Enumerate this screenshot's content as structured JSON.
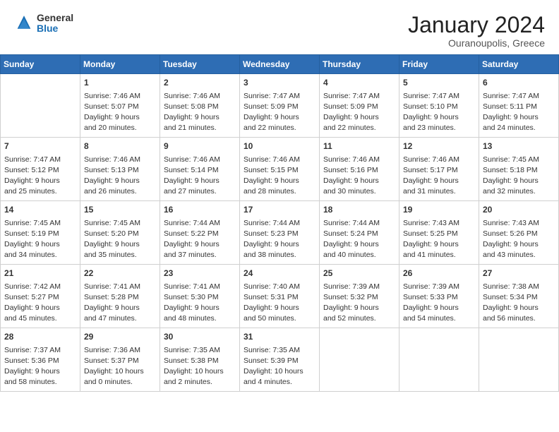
{
  "header": {
    "logo_general": "General",
    "logo_blue": "Blue",
    "month_title": "January 2024",
    "location": "Ouranoupolis, Greece"
  },
  "weekdays": [
    "Sunday",
    "Monday",
    "Tuesday",
    "Wednesday",
    "Thursday",
    "Friday",
    "Saturday"
  ],
  "weeks": [
    [
      {
        "day": "",
        "info": ""
      },
      {
        "day": "1",
        "info": "Sunrise: 7:46 AM\nSunset: 5:07 PM\nDaylight: 9 hours\nand 20 minutes."
      },
      {
        "day": "2",
        "info": "Sunrise: 7:46 AM\nSunset: 5:08 PM\nDaylight: 9 hours\nand 21 minutes."
      },
      {
        "day": "3",
        "info": "Sunrise: 7:47 AM\nSunset: 5:09 PM\nDaylight: 9 hours\nand 22 minutes."
      },
      {
        "day": "4",
        "info": "Sunrise: 7:47 AM\nSunset: 5:09 PM\nDaylight: 9 hours\nand 22 minutes."
      },
      {
        "day": "5",
        "info": "Sunrise: 7:47 AM\nSunset: 5:10 PM\nDaylight: 9 hours\nand 23 minutes."
      },
      {
        "day": "6",
        "info": "Sunrise: 7:47 AM\nSunset: 5:11 PM\nDaylight: 9 hours\nand 24 minutes."
      }
    ],
    [
      {
        "day": "7",
        "info": "Sunrise: 7:47 AM\nSunset: 5:12 PM\nDaylight: 9 hours\nand 25 minutes."
      },
      {
        "day": "8",
        "info": "Sunrise: 7:46 AM\nSunset: 5:13 PM\nDaylight: 9 hours\nand 26 minutes."
      },
      {
        "day": "9",
        "info": "Sunrise: 7:46 AM\nSunset: 5:14 PM\nDaylight: 9 hours\nand 27 minutes."
      },
      {
        "day": "10",
        "info": "Sunrise: 7:46 AM\nSunset: 5:15 PM\nDaylight: 9 hours\nand 28 minutes."
      },
      {
        "day": "11",
        "info": "Sunrise: 7:46 AM\nSunset: 5:16 PM\nDaylight: 9 hours\nand 30 minutes."
      },
      {
        "day": "12",
        "info": "Sunrise: 7:46 AM\nSunset: 5:17 PM\nDaylight: 9 hours\nand 31 minutes."
      },
      {
        "day": "13",
        "info": "Sunrise: 7:45 AM\nSunset: 5:18 PM\nDaylight: 9 hours\nand 32 minutes."
      }
    ],
    [
      {
        "day": "14",
        "info": "Sunrise: 7:45 AM\nSunset: 5:19 PM\nDaylight: 9 hours\nand 34 minutes."
      },
      {
        "day": "15",
        "info": "Sunrise: 7:45 AM\nSunset: 5:20 PM\nDaylight: 9 hours\nand 35 minutes."
      },
      {
        "day": "16",
        "info": "Sunrise: 7:44 AM\nSunset: 5:22 PM\nDaylight: 9 hours\nand 37 minutes."
      },
      {
        "day": "17",
        "info": "Sunrise: 7:44 AM\nSunset: 5:23 PM\nDaylight: 9 hours\nand 38 minutes."
      },
      {
        "day": "18",
        "info": "Sunrise: 7:44 AM\nSunset: 5:24 PM\nDaylight: 9 hours\nand 40 minutes."
      },
      {
        "day": "19",
        "info": "Sunrise: 7:43 AM\nSunset: 5:25 PM\nDaylight: 9 hours\nand 41 minutes."
      },
      {
        "day": "20",
        "info": "Sunrise: 7:43 AM\nSunset: 5:26 PM\nDaylight: 9 hours\nand 43 minutes."
      }
    ],
    [
      {
        "day": "21",
        "info": "Sunrise: 7:42 AM\nSunset: 5:27 PM\nDaylight: 9 hours\nand 45 minutes."
      },
      {
        "day": "22",
        "info": "Sunrise: 7:41 AM\nSunset: 5:28 PM\nDaylight: 9 hours\nand 47 minutes."
      },
      {
        "day": "23",
        "info": "Sunrise: 7:41 AM\nSunset: 5:30 PM\nDaylight: 9 hours\nand 48 minutes."
      },
      {
        "day": "24",
        "info": "Sunrise: 7:40 AM\nSunset: 5:31 PM\nDaylight: 9 hours\nand 50 minutes."
      },
      {
        "day": "25",
        "info": "Sunrise: 7:39 AM\nSunset: 5:32 PM\nDaylight: 9 hours\nand 52 minutes."
      },
      {
        "day": "26",
        "info": "Sunrise: 7:39 AM\nSunset: 5:33 PM\nDaylight: 9 hours\nand 54 minutes."
      },
      {
        "day": "27",
        "info": "Sunrise: 7:38 AM\nSunset: 5:34 PM\nDaylight: 9 hours\nand 56 minutes."
      }
    ],
    [
      {
        "day": "28",
        "info": "Sunrise: 7:37 AM\nSunset: 5:36 PM\nDaylight: 9 hours\nand 58 minutes."
      },
      {
        "day": "29",
        "info": "Sunrise: 7:36 AM\nSunset: 5:37 PM\nDaylight: 10 hours\nand 0 minutes."
      },
      {
        "day": "30",
        "info": "Sunrise: 7:35 AM\nSunset: 5:38 PM\nDaylight: 10 hours\nand 2 minutes."
      },
      {
        "day": "31",
        "info": "Sunrise: 7:35 AM\nSunset: 5:39 PM\nDaylight: 10 hours\nand 4 minutes."
      },
      {
        "day": "",
        "info": ""
      },
      {
        "day": "",
        "info": ""
      },
      {
        "day": "",
        "info": ""
      }
    ]
  ]
}
